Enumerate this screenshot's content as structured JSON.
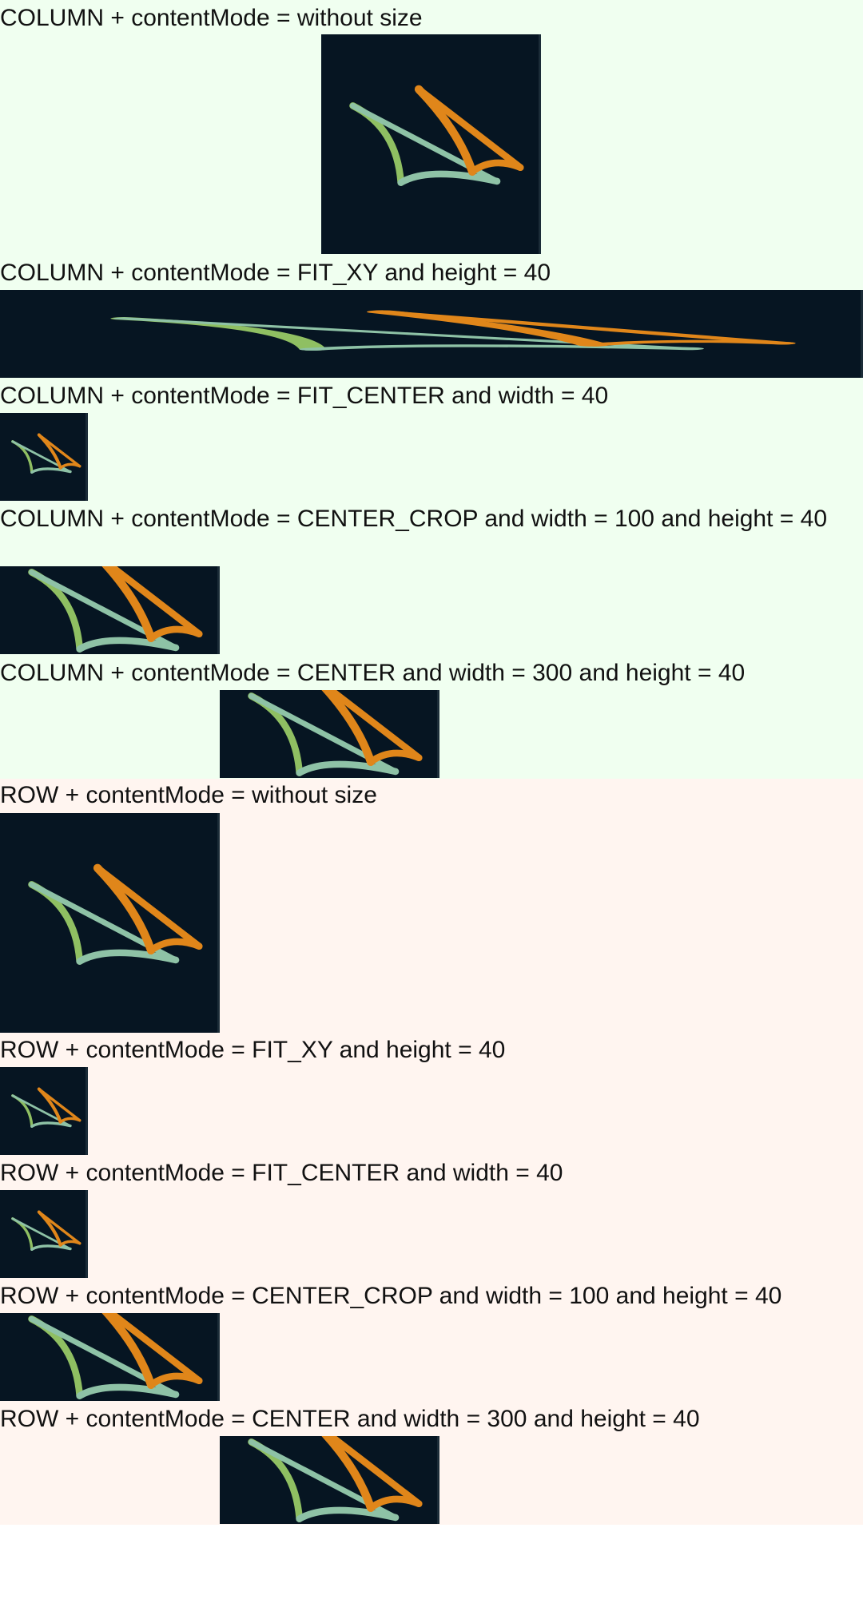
{
  "column_section": {
    "background": "#f0fff0",
    "items": [
      {
        "label": "COLUMN + contentMode = without size"
      },
      {
        "label": "COLUMN + contentMode = FIT_XY and height = 40"
      },
      {
        "label": "COLUMN + contentMode = FIT_CENTER and width = 40"
      },
      {
        "label": "COLUMN + contentMode = CENTER_CROP and width = 100 and height = 40"
      },
      {
        "label": "COLUMN + contentMode = CENTER and width = 300 and height = 40"
      }
    ]
  },
  "row_section": {
    "background": "#fff5f0",
    "items": [
      {
        "label": "ROW + contentMode = without size"
      },
      {
        "label": "ROW + contentMode = FIT_XY and height = 40"
      },
      {
        "label": "ROW + contentMode = FIT_CENTER and width = 40"
      },
      {
        "label": "ROW + contentMode = CENTER_CROP and width = 100 and height = 40"
      },
      {
        "label": "ROW + contentMode = CENTER and width = 300 and height = 40"
      }
    ]
  },
  "image": {
    "icon": "sail-logo-icon",
    "background_color": "#061522",
    "colors": [
      "#8fbf62",
      "#e0861a",
      "#8ec2a6"
    ]
  }
}
